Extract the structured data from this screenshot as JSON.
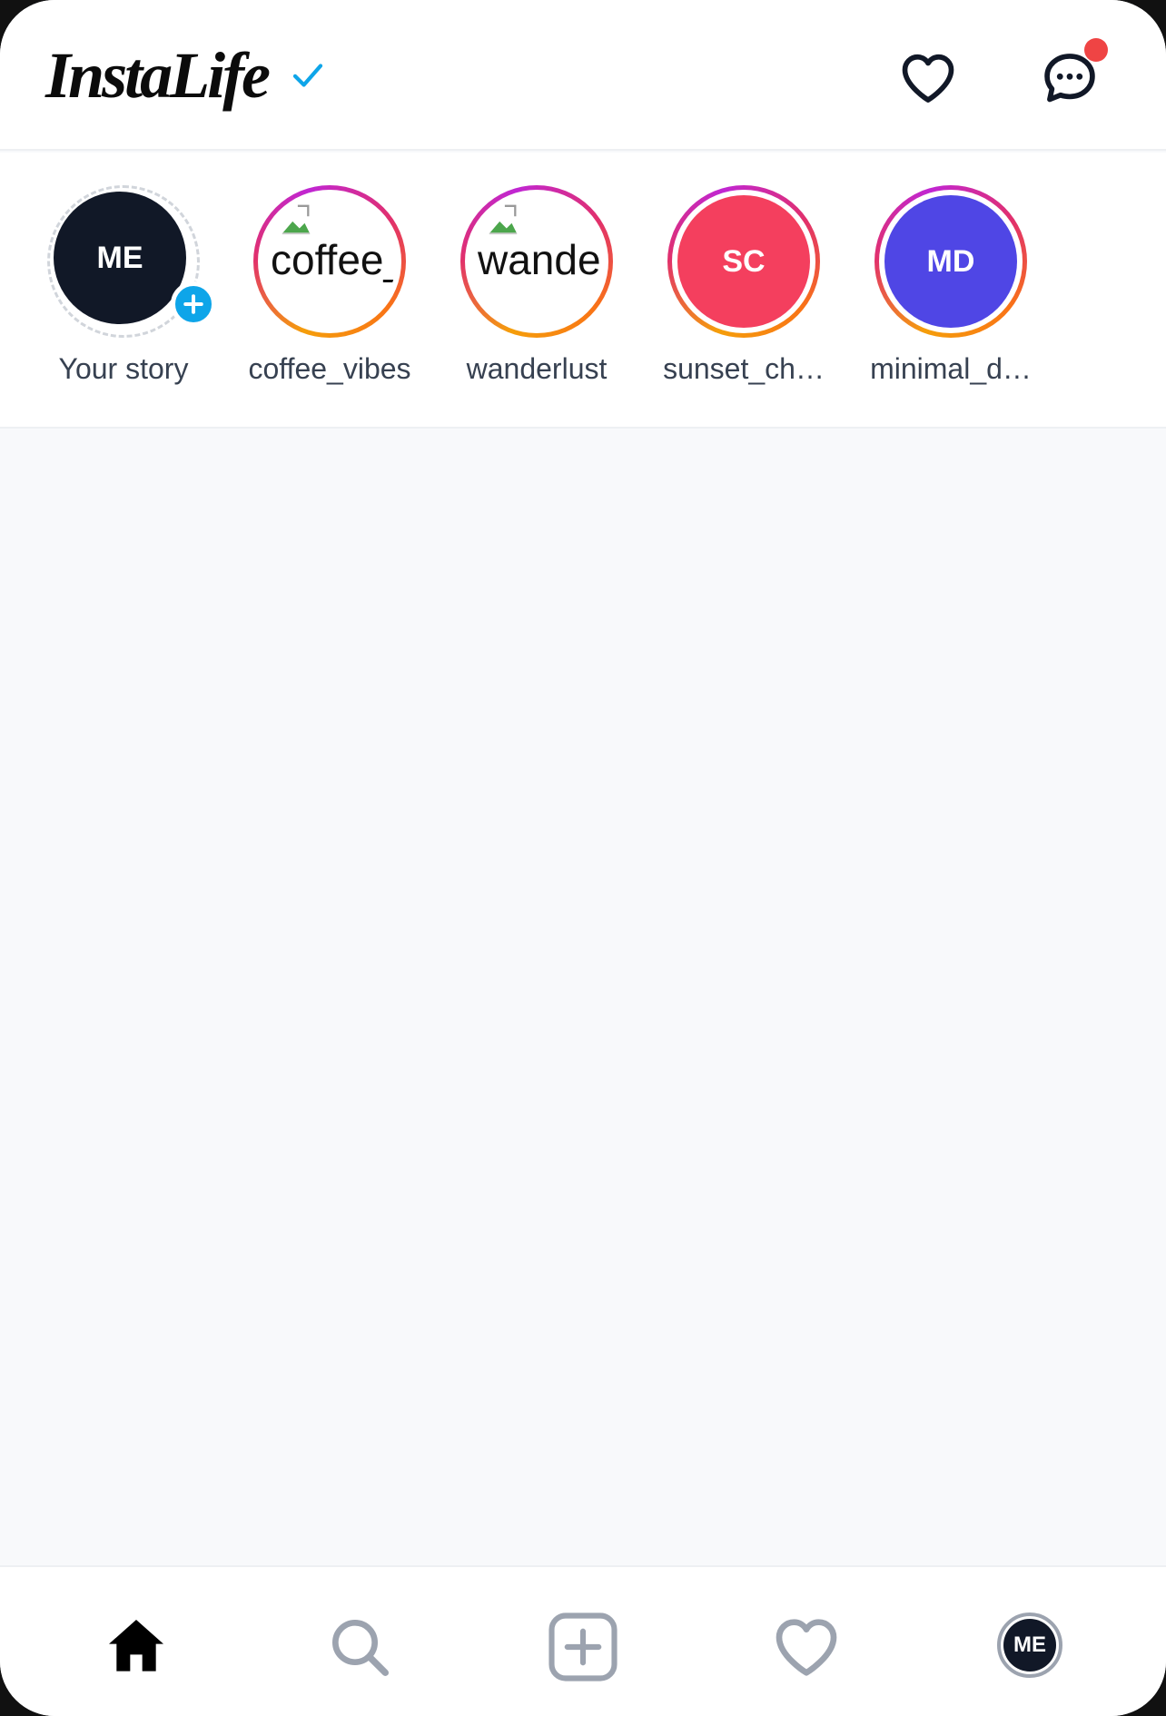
{
  "header": {
    "brand": "InstaLife",
    "verified_icon": "check-icon",
    "notifications_icon": "heart-icon",
    "messages_icon": "chat-bubble-icon",
    "messages_has_unread": true
  },
  "stories": [
    {
      "label": "Your story",
      "avatar_text": "ME",
      "avatar_color": "#111827",
      "is_own": true
    },
    {
      "label": "coffee_vibes",
      "avatar_text": "coffee_",
      "avatar_color": "#ffffff",
      "broken_image": true
    },
    {
      "label": "wanderlust",
      "avatar_text": "wande",
      "avatar_color": "#ffffff",
      "broken_image": true
    },
    {
      "label": "sunset_ch…",
      "avatar_text": "SC",
      "avatar_color": "#f43f5e"
    },
    {
      "label": "minimal_d…",
      "avatar_text": "MD",
      "avatar_color": "#4f46e5"
    }
  ],
  "bottom_nav": {
    "items": [
      "home-icon",
      "search-icon",
      "plus-square-icon",
      "heart-icon",
      "profile-avatar"
    ],
    "active": "home-icon",
    "profile_text": "ME"
  },
  "colors": {
    "accent": "#0ea5e9",
    "notification": "#ef4444",
    "story_ring": "#e1306c"
  }
}
